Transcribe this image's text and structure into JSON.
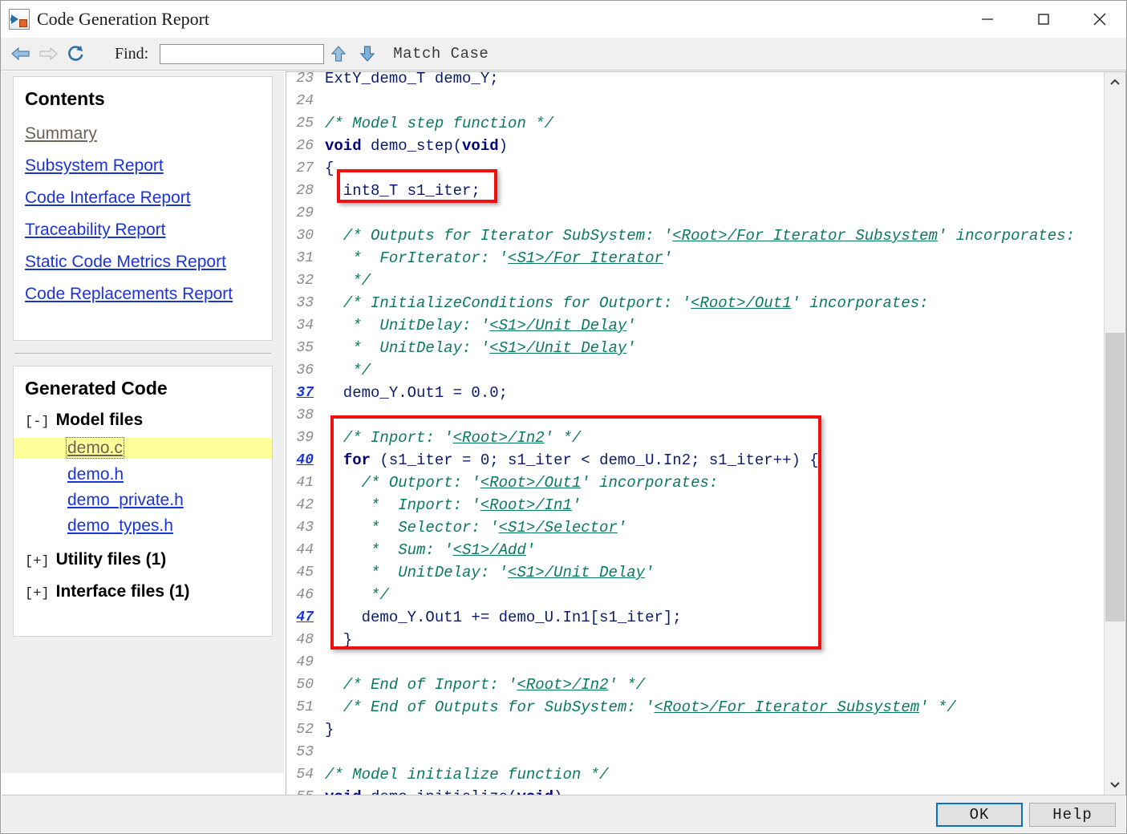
{
  "window": {
    "title": "Code Generation Report",
    "icon": "simulink-report-icon",
    "controls": {
      "minimize": "minimize-icon",
      "maximize": "maximize-icon",
      "close": "close-icon"
    }
  },
  "toolbar": {
    "back": "back-arrow-icon",
    "forward": "forward-arrow-icon",
    "refresh": "refresh-icon",
    "find_label": "Find:",
    "find_value": "",
    "find_placeholder": "",
    "find_prev": "find-up-arrow-icon",
    "find_next": "find-down-arrow-icon",
    "match_case": "Match Case"
  },
  "sidebar": {
    "contents": {
      "title": "Contents",
      "links": [
        {
          "label": "Summary",
          "state": "visited"
        },
        {
          "label": "Subsystem Report",
          "state": "link"
        },
        {
          "label": "Code Interface Report",
          "state": "link"
        },
        {
          "label": "Traceability Report",
          "state": "link"
        },
        {
          "label": "Static Code Metrics Report",
          "state": "link"
        },
        {
          "label": "Code Replacements Report",
          "state": "link"
        }
      ]
    },
    "generated_code": {
      "title": "Generated Code",
      "groups": [
        {
          "toggle": "[-]",
          "label": "Model files",
          "expanded": true,
          "files": [
            {
              "name": "demo.c",
              "selected": true
            },
            {
              "name": "demo.h",
              "selected": false
            },
            {
              "name": "demo_private.h",
              "selected": false
            },
            {
              "name": "demo_types.h",
              "selected": false
            }
          ]
        },
        {
          "toggle": "[+]",
          "label": "Utility files (1)",
          "expanded": false,
          "files": []
        },
        {
          "toggle": "[+]",
          "label": "Interface files (1)",
          "expanded": false,
          "files": []
        }
      ]
    }
  },
  "code": {
    "file": "demo.c",
    "lines": [
      {
        "n": "23",
        "link": false,
        "tokens": [
          {
            "t": "code",
            "s": "ExtY_demo_T demo_Y;"
          }
        ]
      },
      {
        "n": "24",
        "link": false,
        "tokens": []
      },
      {
        "n": "25",
        "link": false,
        "tokens": [
          {
            "t": "cmt",
            "s": "/* Model step function */"
          }
        ]
      },
      {
        "n": "26",
        "link": false,
        "tokens": [
          {
            "t": "kw",
            "s": "void"
          },
          {
            "t": "code",
            "s": " demo_step("
          },
          {
            "t": "kw",
            "s": "void"
          },
          {
            "t": "code",
            "s": ")"
          }
        ]
      },
      {
        "n": "27",
        "link": false,
        "tokens": [
          {
            "t": "code",
            "s": "{"
          }
        ]
      },
      {
        "n": "28",
        "link": false,
        "tokens": [
          {
            "t": "code",
            "s": "  int8_T s1_iter;"
          }
        ]
      },
      {
        "n": "29",
        "link": false,
        "tokens": []
      },
      {
        "n": "30",
        "link": false,
        "tokens": [
          {
            "t": "cmt",
            "s": "  /* Outputs for Iterator SubSystem: '"
          },
          {
            "t": "lnk",
            "s": "<Root>/For Iterator Subsystem"
          },
          {
            "t": "cmt",
            "s": "' incorporates:"
          }
        ]
      },
      {
        "n": "31",
        "link": false,
        "tokens": [
          {
            "t": "cmt",
            "s": "   *  ForIterator: '"
          },
          {
            "t": "lnk",
            "s": "<S1>/For Iterator"
          },
          {
            "t": "cmt",
            "s": "'"
          }
        ]
      },
      {
        "n": "32",
        "link": false,
        "tokens": [
          {
            "t": "cmt",
            "s": "   */"
          }
        ]
      },
      {
        "n": "33",
        "link": false,
        "tokens": [
          {
            "t": "cmt",
            "s": "  /* InitializeConditions for Outport: '"
          },
          {
            "t": "lnk",
            "s": "<Root>/Out1"
          },
          {
            "t": "cmt",
            "s": "' incorporates:"
          }
        ]
      },
      {
        "n": "34",
        "link": false,
        "tokens": [
          {
            "t": "cmt",
            "s": "   *  UnitDelay: '"
          },
          {
            "t": "lnk",
            "s": "<S1>/Unit Delay"
          },
          {
            "t": "cmt",
            "s": "'"
          }
        ]
      },
      {
        "n": "35",
        "link": false,
        "tokens": [
          {
            "t": "cmt",
            "s": "   *  UnitDelay: '"
          },
          {
            "t": "lnk",
            "s": "<S1>/Unit Delay"
          },
          {
            "t": "cmt",
            "s": "'"
          }
        ]
      },
      {
        "n": "36",
        "link": false,
        "tokens": [
          {
            "t": "cmt",
            "s": "   */"
          }
        ]
      },
      {
        "n": "37",
        "link": true,
        "tokens": [
          {
            "t": "code",
            "s": "  demo_Y.Out1 = 0.0;"
          }
        ]
      },
      {
        "n": "38",
        "link": false,
        "tokens": []
      },
      {
        "n": "39",
        "link": false,
        "tokens": [
          {
            "t": "cmt",
            "s": "  /* Inport: '"
          },
          {
            "t": "lnk",
            "s": "<Root>/In2"
          },
          {
            "t": "cmt",
            "s": "' */"
          }
        ]
      },
      {
        "n": "40",
        "link": true,
        "tokens": [
          {
            "t": "code",
            "s": "  "
          },
          {
            "t": "kw",
            "s": "for"
          },
          {
            "t": "code",
            "s": " (s1_iter = 0; s1_iter < demo_U.In2; s1_iter++) {"
          }
        ]
      },
      {
        "n": "41",
        "link": false,
        "tokens": [
          {
            "t": "cmt",
            "s": "    /* Outport: '"
          },
          {
            "t": "lnk",
            "s": "<Root>/Out1"
          },
          {
            "t": "cmt",
            "s": "' incorporates:"
          }
        ]
      },
      {
        "n": "42",
        "link": false,
        "tokens": [
          {
            "t": "cmt",
            "s": "     *  Inport: '"
          },
          {
            "t": "lnk",
            "s": "<Root>/In1"
          },
          {
            "t": "cmt",
            "s": "'"
          }
        ]
      },
      {
        "n": "43",
        "link": false,
        "tokens": [
          {
            "t": "cmt",
            "s": "     *  Selector: '"
          },
          {
            "t": "lnk",
            "s": "<S1>/Selector"
          },
          {
            "t": "cmt",
            "s": "'"
          }
        ]
      },
      {
        "n": "44",
        "link": false,
        "tokens": [
          {
            "t": "cmt",
            "s": "     *  Sum: '"
          },
          {
            "t": "lnk",
            "s": "<S1>/Add"
          },
          {
            "t": "cmt",
            "s": "'"
          }
        ]
      },
      {
        "n": "45",
        "link": false,
        "tokens": [
          {
            "t": "cmt",
            "s": "     *  UnitDelay: '"
          },
          {
            "t": "lnk",
            "s": "<S1>/Unit Delay"
          },
          {
            "t": "cmt",
            "s": "'"
          }
        ]
      },
      {
        "n": "46",
        "link": false,
        "tokens": [
          {
            "t": "cmt",
            "s": "     */"
          }
        ]
      },
      {
        "n": "47",
        "link": true,
        "tokens": [
          {
            "t": "code",
            "s": "    demo_Y.Out1 += demo_U.In1[s1_iter];"
          }
        ]
      },
      {
        "n": "48",
        "link": false,
        "tokens": [
          {
            "t": "code",
            "s": "  }"
          }
        ]
      },
      {
        "n": "49",
        "link": false,
        "tokens": []
      },
      {
        "n": "50",
        "link": false,
        "tokens": [
          {
            "t": "cmt",
            "s": "  /* End of Inport: '"
          },
          {
            "t": "lnk",
            "s": "<Root>/In2"
          },
          {
            "t": "cmt",
            "s": "' */"
          }
        ]
      },
      {
        "n": "51",
        "link": false,
        "tokens": [
          {
            "t": "cmt",
            "s": "  /* End of Outputs for SubSystem: '"
          },
          {
            "t": "lnk",
            "s": "<Root>/For Iterator Subsystem"
          },
          {
            "t": "cmt",
            "s": "' */"
          }
        ]
      },
      {
        "n": "52",
        "link": false,
        "tokens": [
          {
            "t": "code",
            "s": "}"
          }
        ]
      },
      {
        "n": "53",
        "link": false,
        "tokens": []
      },
      {
        "n": "54",
        "link": false,
        "tokens": [
          {
            "t": "cmt",
            "s": "/* Model initialize function */"
          }
        ]
      },
      {
        "n": "55",
        "link": false,
        "tokens": [
          {
            "t": "kw",
            "s": "void"
          },
          {
            "t": "code",
            "s": " demo_initialize("
          },
          {
            "t": "kw",
            "s": "void"
          },
          {
            "t": "code",
            "s": ")"
          }
        ]
      }
    ],
    "annotations": [
      {
        "name": "declaration-highlight",
        "target_line": "28",
        "color": "#ee1111"
      },
      {
        "name": "for-loop-highlight",
        "target_lines": "39-48",
        "color": "#ee1111"
      }
    ],
    "scrollbar": {
      "up": "scroll-up-icon",
      "down": "scroll-down-icon",
      "position_pct": 46
    }
  },
  "footer": {
    "ok": "OK",
    "help": "Help"
  },
  "colors": {
    "link": "#1a34d8",
    "visited_link": "#6b6257",
    "comment": "#0a7a5e",
    "keyword": "#00007f",
    "code": "#0b1a6b",
    "annotation": "#ee1111",
    "selection": "#ffff99",
    "focus": "#0a72c4"
  }
}
